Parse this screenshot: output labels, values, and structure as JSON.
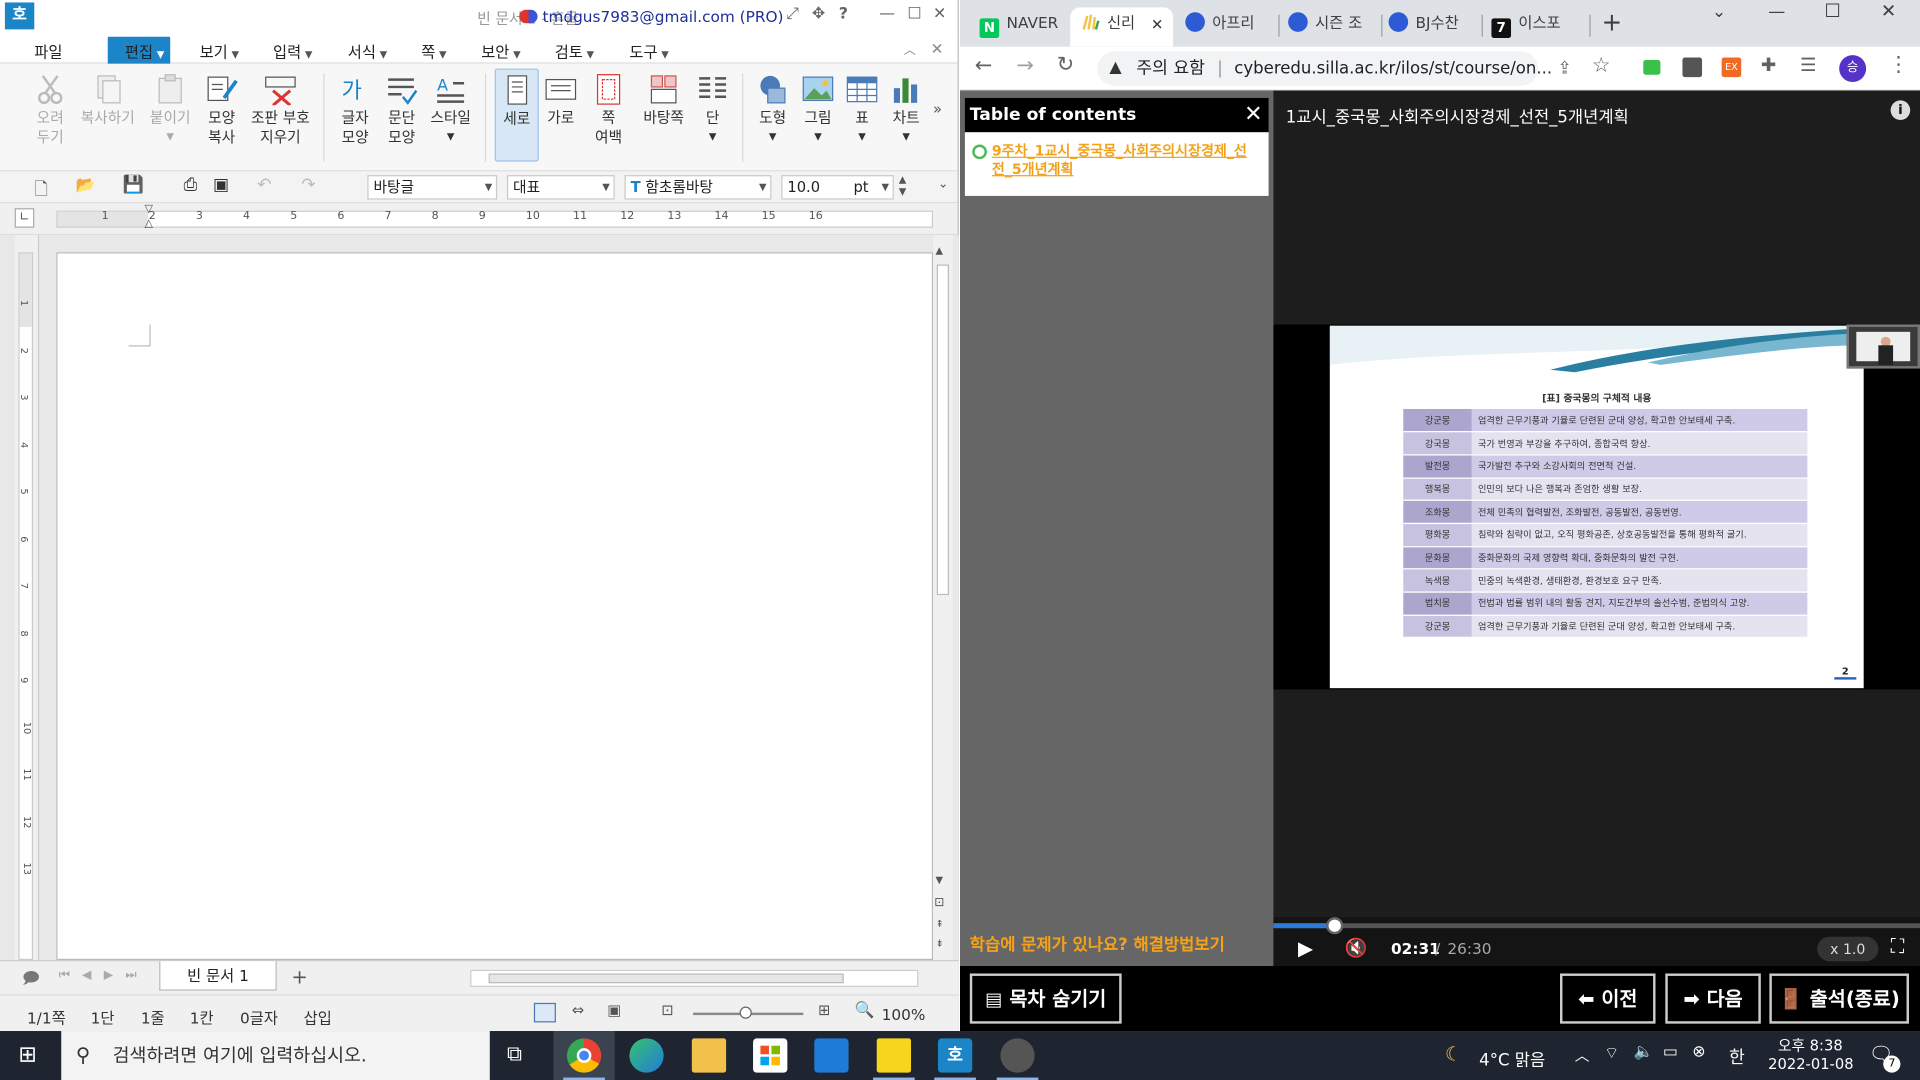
{
  "hwp": {
    "title": "빈 문서 1 - 흔글",
    "account": "tmdgus7983@gmail.com (PRO)",
    "menu": [
      "파일",
      "편집",
      "보기",
      "입력",
      "서식",
      "쪽",
      "보안",
      "검토",
      "도구"
    ],
    "ribbon": {
      "cut": "오려\n두기",
      "copy": "복사하기",
      "paste": "붙이기",
      "format_copy": "모양\n복사",
      "clear_codes": "조판 부호\n지우기",
      "char_shape": "글자\n모양",
      "para_shape": "문단\n모양",
      "style": "스타일",
      "portrait": "세로",
      "landscape": "가로",
      "page_margin": "쪽\n여백",
      "background": "바탕쪽",
      "columns": "단",
      "shape": "도형",
      "picture": "그림",
      "table": "표",
      "chart": "차트"
    },
    "fmt": {
      "style": "바탕글",
      "lang": "대표",
      "font": "함초롬바탕",
      "size": "10.0",
      "unit": "pt"
    },
    "ruler_numbers": [
      "1",
      "2",
      "3",
      "4",
      "5",
      "6",
      "7",
      "8",
      "9",
      "10",
      "11",
      "12",
      "13",
      "14",
      "15",
      "16"
    ],
    "vruler_numbers": [
      "1",
      "2",
      "3",
      "4",
      "5",
      "6",
      "7",
      "8",
      "9",
      "10",
      "11",
      "12",
      "13"
    ],
    "tab_name": "빈 문서 1",
    "status": {
      "page": "1/1쪽",
      "section": "1단",
      "line": "1줄",
      "column": "1칸",
      "chars": "0글자",
      "mode": "삽입",
      "zoom": "100%"
    }
  },
  "chrome": {
    "tabs": [
      {
        "label": "NAVER",
        "color": "#03c75a"
      },
      {
        "label": "신리",
        "color": "#f4c542"
      },
      {
        "label": "아프리",
        "color": "#2d5bd6"
      },
      {
        "label": "시즌 조",
        "color": "#2d5bd6"
      },
      {
        "label": "BJ수찬",
        "color": "#2d5bd6"
      },
      {
        "label": "이스포",
        "color": "#111111"
      }
    ],
    "security": "주의 요함",
    "url": "cyberedu.silla.ac.kr/ilos/st/course/on...",
    "profile_initial": "승"
  },
  "lecture": {
    "toc_title": "Table of contents",
    "toc_item": "9주차_1교시_중국몽_사회주의시장경제_선전_5개년계획",
    "video_title": "1교시_중국몽_사회주의시장경제_선전_5개년계획",
    "help_text": "학습에 문제가 있나요? 해결방법보기",
    "current_time": "02:31",
    "total_time": "26:30",
    "progress": 0.095,
    "speed": "x 1.0",
    "btn_toc": "목차 숨기기",
    "btn_prev": "이전",
    "btn_next": "다음",
    "btn_exit": "출석(종료)"
  },
  "slide": {
    "caption": "[표] 중국몽의 구체적 내용",
    "page": "2",
    "rows": [
      {
        "k": "강군몽",
        "v": "엄격한 근무기풍과 기율로 단련된 군대 양성, 확고한 안보태세 구축."
      },
      {
        "k": "강국몽",
        "v": "국가 번영과 부강을 추구하여, 종합국력 향상."
      },
      {
        "k": "발전몽",
        "v": "국가발전 추구와 소강사회의 전면적 건설."
      },
      {
        "k": "행복몽",
        "v": "인민의 보다 나은 행복과 존엄한 생활 보장."
      },
      {
        "k": "조화몽",
        "v": "전체 민족의 협력발전, 조화발전, 공동발전, 공동번영."
      },
      {
        "k": "평화몽",
        "v": "침략와 침략이 없고, 오직 평화공존, 상호공동발전을 통해 평화적 굴기."
      },
      {
        "k": "문화몽",
        "v": "중화문화의 국제 영향력 확대, 중화문화의 발전 구현."
      },
      {
        "k": "녹색몽",
        "v": "민중의 녹색환경, 생태환경, 환경보호 요구 만족."
      },
      {
        "k": "법치몽",
        "v": "헌법과 법률 범위 내의 활동 견지, 지도간부의 솔선수범, 준법의식 고양."
      },
      {
        "k": "강군몽",
        "v": "엄격한 근무기풍과 기율로 단련된 군대 양성, 확고한 안보태세 구축."
      }
    ]
  },
  "taskbar": {
    "search_placeholder": "검색하려면 여기에 입력하십시오.",
    "weather": "4°C  맑음",
    "ime": "한",
    "time": "오후 8:38",
    "date": "2022-01-08",
    "notifications": "7"
  }
}
